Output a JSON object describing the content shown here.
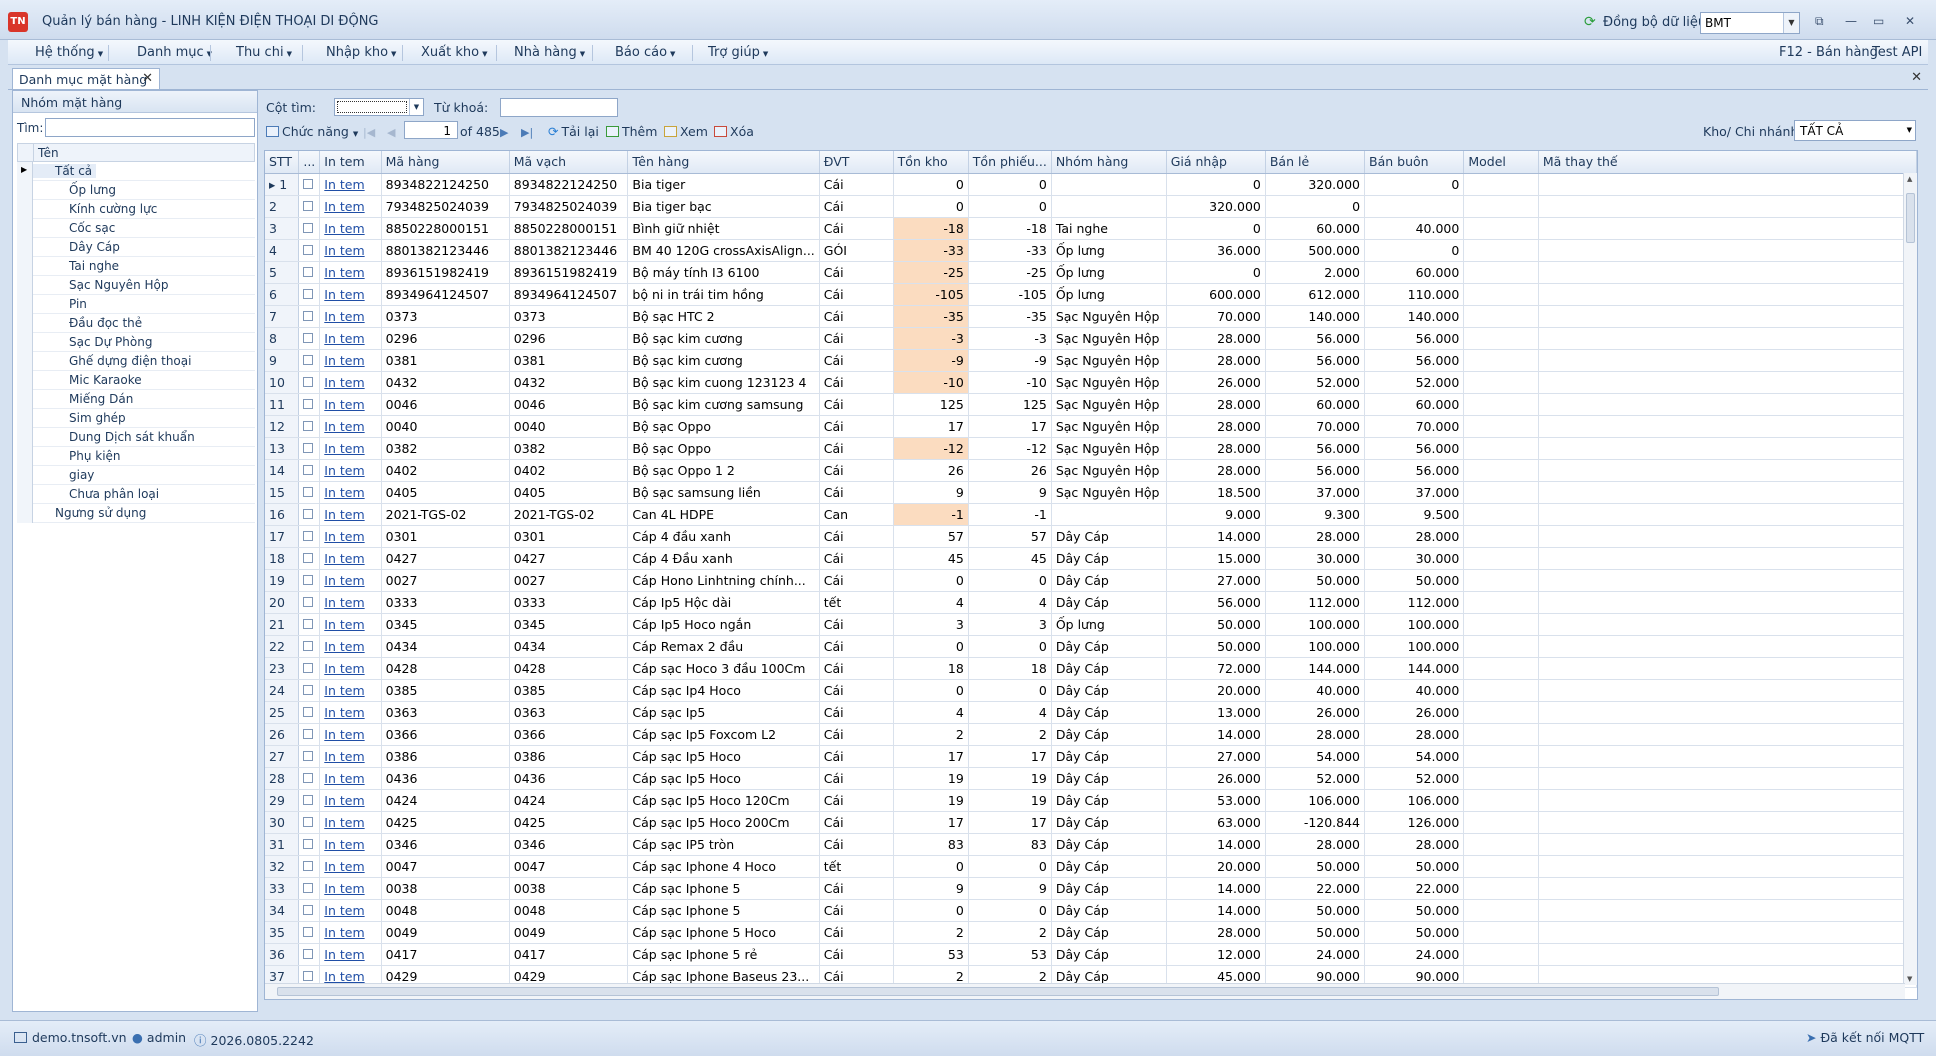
{
  "app": {
    "icon_text": "TN",
    "title": "Quản lý bán hàng - LINH KIỆN ĐIỆN THOẠI DI ĐỘNG",
    "sync_label": "Đồng bộ dữ liệu",
    "branch": "BMT",
    "win_buttons": [
      "⧉",
      "—",
      "▭",
      "✕"
    ]
  },
  "menu": {
    "items": [
      "Hệ thống",
      "Danh mục",
      "Thu chi",
      "Nhập kho",
      "Xuất kho",
      "Nhà hàng",
      "Báo cáo",
      "Trợ giúp"
    ],
    "right": [
      "F12 - Bán hàng",
      "Test API"
    ]
  },
  "tab": {
    "label": "Danh mục mặt hàng"
  },
  "left": {
    "header": "Nhóm mặt hàng",
    "search_label": "Tìm:",
    "tree_header": "Tên",
    "items": [
      {
        "label": "Tất cả",
        "level": 1
      },
      {
        "label": "Ốp lưng",
        "level": 2
      },
      {
        "label": "Kính cường lực",
        "level": 2
      },
      {
        "label": "Cốc sạc",
        "level": 2
      },
      {
        "label": "Dây Cáp",
        "level": 2
      },
      {
        "label": "Tai nghe",
        "level": 2
      },
      {
        "label": "Sạc Nguyên Hộp",
        "level": 2
      },
      {
        "label": "Pin",
        "level": 2
      },
      {
        "label": "Đầu đọc thẻ",
        "level": 2
      },
      {
        "label": "Sạc Dự Phòng",
        "level": 2
      },
      {
        "label": "Ghế dựng điện thoại",
        "level": 2
      },
      {
        "label": "Mic Karaoke",
        "level": 2
      },
      {
        "label": "Miếng Dán",
        "level": 2
      },
      {
        "label": "Sim ghép",
        "level": 2
      },
      {
        "label": "Dung Dịch sát khuẩn",
        "level": 2
      },
      {
        "label": "Phụ kiện",
        "level": 2
      },
      {
        "label": "giay",
        "level": 2
      },
      {
        "label": "Chưa phân loại",
        "level": 2
      },
      {
        "label": "Ngưng sử dụng",
        "level": 1
      }
    ]
  },
  "toolbar": {
    "col_search_label": "Cột tìm:",
    "keyword_label": "Từ khoá:",
    "functions": "Chức năng",
    "page": "1",
    "page_of": "of 485",
    "reload": "Tải lại",
    "add": "Thêm",
    "view": "Xem",
    "delete": "Xóa",
    "branch_label": "Kho/ Chi nhánh:",
    "branch_value": "TẤT CẢ"
  },
  "grid": {
    "columns": [
      "STT",
      "...",
      "In tem",
      "Mã hàng",
      "Mã vạch",
      "Tên hàng",
      "ĐVT",
      "Tồn kho",
      "Tồn phiếu...",
      "Nhóm hàng",
      "Giá nhập",
      "Bán lẻ",
      "Bán buôn",
      "Model",
      "Mã thay thế"
    ],
    "link_text": "In tem",
    "rows": [
      [
        "1",
        "8934822124250",
        "8934822124250",
        "Bia tiger",
        "Cái",
        "0",
        "0",
        "",
        "0",
        "320.000",
        "0"
      ],
      [
        "2",
        "7934825024039",
        "7934825024039",
        "Bia tiger bạc",
        "Cái",
        "0",
        "0",
        "",
        "320.000",
        "0",
        ""
      ],
      [
        "3",
        "8850228000151",
        "8850228000151",
        "Bình giữ nhiệt",
        "Cái",
        "-18",
        "-18",
        "Tai nghe",
        "0",
        "60.000",
        "40.000"
      ],
      [
        "4",
        "8801382123446",
        "8801382123446",
        "BM 40 120G crossAxisAlign...",
        "GÓI",
        "-33",
        "-33",
        "Ốp lưng",
        "36.000",
        "500.000",
        "0"
      ],
      [
        "5",
        "8936151982419",
        "8936151982419",
        "Bộ máy tính I3 6100",
        "Cái",
        "-25",
        "-25",
        "Ốp lưng",
        "0",
        "2.000",
        "60.000"
      ],
      [
        "6",
        "8934964124507",
        "8934964124507",
        "bộ ni in trái tim hồng",
        "Cái",
        "-105",
        "-105",
        "Ốp lưng",
        "600.000",
        "612.000",
        "110.000"
      ],
      [
        "7",
        "0373",
        "0373",
        "Bộ sạc HTC 2",
        "Cái",
        "-35",
        "-35",
        "Sạc Nguyên Hộp",
        "70.000",
        "140.000",
        "140.000"
      ],
      [
        "8",
        "0296",
        "0296",
        "Bộ sạc kim cương",
        "Cái",
        "-3",
        "-3",
        "Sạc Nguyên Hộp",
        "28.000",
        "56.000",
        "56.000"
      ],
      [
        "9",
        "0381",
        "0381",
        "Bộ sạc kim cương",
        "Cái",
        "-9",
        "-9",
        "Sạc Nguyên Hộp",
        "28.000",
        "56.000",
        "56.000"
      ],
      [
        "10",
        "0432",
        "0432",
        "Bộ sạc kim cuong 123123 4",
        "Cái",
        "-10",
        "-10",
        "Sạc Nguyên Hộp",
        "26.000",
        "52.000",
        "52.000"
      ],
      [
        "11",
        "0046",
        "0046",
        "Bộ sạc kim cương samsung",
        "Cái",
        "125",
        "125",
        "Sạc Nguyên Hộp",
        "28.000",
        "60.000",
        "60.000"
      ],
      [
        "12",
        "0040",
        "0040",
        "Bộ sạc Oppo",
        "Cái",
        "17",
        "17",
        "Sạc Nguyên Hộp",
        "28.000",
        "70.000",
        "70.000"
      ],
      [
        "13",
        "0382",
        "0382",
        "Bộ sạc Oppo",
        "Cái",
        "-12",
        "-12",
        "Sạc Nguyên Hộp",
        "28.000",
        "56.000",
        "56.000"
      ],
      [
        "14",
        "0402",
        "0402",
        "Bộ sạc Oppo 1 2",
        "Cái",
        "26",
        "26",
        "Sạc Nguyên Hộp",
        "28.000",
        "56.000",
        "56.000"
      ],
      [
        "15",
        "0405",
        "0405",
        "Bộ sạc samsung liền",
        "Cái",
        "9",
        "9",
        "Sạc Nguyên Hộp",
        "18.500",
        "37.000",
        "37.000"
      ],
      [
        "16",
        "2021-TGS-02",
        "2021-TGS-02",
        "Can 4L HDPE",
        "Can",
        "-1",
        "-1",
        "",
        "9.000",
        "9.300",
        "9.500"
      ],
      [
        "17",
        "0301",
        "0301",
        "Cáp 4 đầu xanh",
        "Cái",
        "57",
        "57",
        "Dây Cáp",
        "14.000",
        "28.000",
        "28.000"
      ],
      [
        "18",
        "0427",
        "0427",
        "Cáp 4 Đầu xanh",
        "Cái",
        "45",
        "45",
        "Dây Cáp",
        "15.000",
        "30.000",
        "30.000"
      ],
      [
        "19",
        "0027",
        "0027",
        "Cáp Hono Linhtning chính...",
        "Cái",
        "0",
        "0",
        "Dây Cáp",
        "27.000",
        "50.000",
        "50.000"
      ],
      [
        "20",
        "0333",
        "0333",
        "Cáp Ip5 Hộc dài",
        "tết",
        "4",
        "4",
        "Dây Cáp",
        "56.000",
        "112.000",
        "112.000"
      ],
      [
        "21",
        "0345",
        "0345",
        "Cáp Ip5 Hoco ngắn",
        "Cái",
        "3",
        "3",
        "Ốp lưng",
        "50.000",
        "100.000",
        "100.000"
      ],
      [
        "22",
        "0434",
        "0434",
        "Cáp Remax 2 đầu",
        "Cái",
        "0",
        "0",
        "Dây Cáp",
        "50.000",
        "100.000",
        "100.000"
      ],
      [
        "23",
        "0428",
        "0428",
        "Cáp sạc Hoco 3 đầu 100Cm",
        "Cái",
        "18",
        "18",
        "Dây Cáp",
        "72.000",
        "144.000",
        "144.000"
      ],
      [
        "24",
        "0385",
        "0385",
        "Cáp sạc Ip4 Hoco",
        "Cái",
        "0",
        "0",
        "Dây Cáp",
        "20.000",
        "40.000",
        "40.000"
      ],
      [
        "25",
        "0363",
        "0363",
        "Cáp sạc Ip5",
        "Cái",
        "4",
        "4",
        "Dây Cáp",
        "13.000",
        "26.000",
        "26.000"
      ],
      [
        "26",
        "0366",
        "0366",
        "Cáp sạc Ip5 Foxcom L2",
        "Cái",
        "2",
        "2",
        "Dây Cáp",
        "14.000",
        "28.000",
        "28.000"
      ],
      [
        "27",
        "0386",
        "0386",
        "Cáp sạc Ip5 Hoco",
        "Cái",
        "17",
        "17",
        "Dây Cáp",
        "27.000",
        "54.000",
        "54.000"
      ],
      [
        "28",
        "0436",
        "0436",
        "Cáp sạc Ip5 Hoco",
        "Cái",
        "19",
        "19",
        "Dây Cáp",
        "26.000",
        "52.000",
        "52.000"
      ],
      [
        "29",
        "0424",
        "0424",
        "Cáp sạc Ip5 Hoco 120Cm",
        "Cái",
        "19",
        "19",
        "Dây Cáp",
        "53.000",
        "106.000",
        "106.000"
      ],
      [
        "30",
        "0425",
        "0425",
        "Cáp sạc Ip5 Hoco 200Cm",
        "Cái",
        "17",
        "17",
        "Dây Cáp",
        "63.000",
        "-120.844",
        "126.000"
      ],
      [
        "31",
        "0346",
        "0346",
        "Cáp sạc IP5 tròn",
        "Cái",
        "83",
        "83",
        "Dây Cáp",
        "14.000",
        "28.000",
        "28.000"
      ],
      [
        "32",
        "0047",
        "0047",
        "Cáp sạc Iphone 4 Hoco",
        "tết",
        "0",
        "0",
        "Dây Cáp",
        "20.000",
        "50.000",
        "50.000"
      ],
      [
        "33",
        "0038",
        "0038",
        "Cáp sạc Iphone 5",
        "Cái",
        "9",
        "9",
        "Dây Cáp",
        "14.000",
        "22.000",
        "22.000"
      ],
      [
        "34",
        "0048",
        "0048",
        "Cáp sạc Iphone 5",
        "Cái",
        "0",
        "0",
        "Dây Cáp",
        "14.000",
        "50.000",
        "50.000"
      ],
      [
        "35",
        "0049",
        "0049",
        "Cáp sạc Iphone 5 Hoco",
        "Cái",
        "2",
        "2",
        "Dây Cáp",
        "28.000",
        "50.000",
        "50.000"
      ],
      [
        "36",
        "0417",
        "0417",
        "Cáp sạc Iphone 5 rẻ",
        "Cái",
        "53",
        "53",
        "Dây Cáp",
        "12.000",
        "24.000",
        "24.000"
      ],
      [
        "37",
        "0429",
        "0429",
        "Cáp sạc Iphone Baseus 23...",
        "Cái",
        "2",
        "2",
        "Dây Cáp",
        "45.000",
        "90.000",
        "90.000"
      ]
    ]
  },
  "status": {
    "server": "demo.tnsoft.vn",
    "user": "admin",
    "version": "2026.0805.2242",
    "mqtt": "Đã kết nối MQTT"
  },
  "colors": {
    "negative_stock": "#fbdcc0",
    "link": "#1f4ea6",
    "accent": "#1e395b"
  }
}
